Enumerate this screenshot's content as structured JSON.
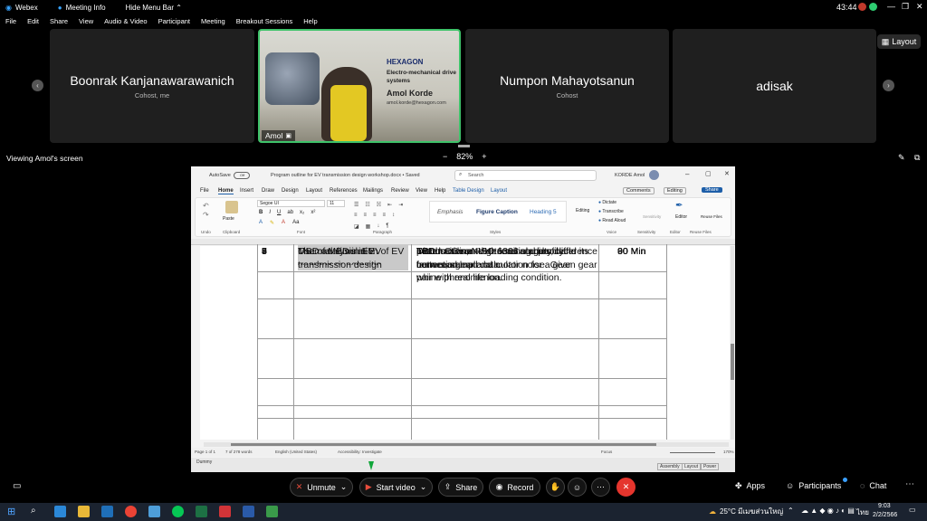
{
  "titlebar": {
    "app": "Webex",
    "meeting_info": "Meeting Info",
    "hide_menu": "Hide Menu Bar ⌃",
    "time": "43:44"
  },
  "menu": [
    "File",
    "Edit",
    "Share",
    "View",
    "Audio & Video",
    "Participant",
    "Meeting",
    "Breakout Sessions",
    "Help"
  ],
  "layout_label": "Layout",
  "participants": [
    {
      "name": "Boonrak Kanjanawarawanich",
      "role": "Cohost, me"
    },
    {
      "name": "Amol",
      "role": ""
    },
    {
      "name": "Numpon Mahayotsanun",
      "role": "Cohost"
    },
    {
      "name": "adisak",
      "role": ""
    }
  ],
  "video_slide": {
    "brand": "HEXAGON",
    "line1": "Electro-mechanical drive",
    "line2": "systems",
    "presenter": "Amol Korde",
    "email": "amol.korde@hexagon.com"
  },
  "viewing": "Viewing Amol's screen",
  "zoom": "82%",
  "word": {
    "autosave": "AutoSave",
    "autosave_state": "Off",
    "doc_title": "Program outline for EV transmission design workshop.docx • Saved",
    "search": "Search",
    "user": "KORDE Amol",
    "tabs": [
      "File",
      "Home",
      "Insert",
      "Draw",
      "Design",
      "Layout",
      "References",
      "Mailings",
      "Review",
      "View",
      "Help",
      "Table Design",
      "Layout"
    ],
    "comments": "Comments",
    "editing": "Editing",
    "share": "Share",
    "font": "Segoe UI",
    "font_size": "11",
    "styles": [
      "Emphasis",
      "Figure Caption",
      "Heading 5"
    ],
    "ribbon_groups": [
      "Undo",
      "Clipboard",
      "Font",
      "Paragraph",
      "Styles",
      "Voice",
      "Sensitivity",
      "Editor",
      "Reuse Files"
    ],
    "ribbon_buttons": [
      "Paste",
      "Dictate",
      "Transcribe",
      "Read Aloud",
      "Editing",
      "Sensitivity",
      "Editor",
      "Reuse Files"
    ],
    "status": [
      "Page 1 of 1",
      "7 of 278 words",
      "English (United States)",
      "Accessibility: Investigate",
      "Focus",
      "170%"
    ],
    "zoom_level": "170%"
  },
  "table_rows": [
    {
      "num": "",
      "topic": "",
      "desc": "pattern. Gear teeth lead and profile correction.",
      "time": ""
    },
    {
      "num": "4",
      "topic": "Gearbox duty cycle generation",
      "desc": "Load cases and generating duty cycle from road load data.",
      "time": "60 Min"
    },
    {
      "num": "5",
      "topic": "Gear rating using ISO 6336",
      "desc": "Discussion on ISO 6336 standard and its factors, sample calculation for a given gear pair with real life loading condition.",
      "time": "90 Min"
    },
    {
      "num": "6",
      "topic": "Introduction to gearbox NVH",
      "desc": "Introduction, NVH terminologies, difference between gear and motor noise. Gear whine phenomenon.",
      "time": "60 Min"
    },
    {
      "num": "7",
      "topic": "Use of MBD in EV transmission design",
      "desc": "TBD",
      "time": "60 Min"
    },
    {
      "num": "8",
      "topic": "MBD analysis in EV",
      "desc": "TBD",
      "time": "90 Min"
    },
    {
      "num": "9",
      "topic": "Thermal simulation of EV gearbox or acoustic",
      "desc": "TBD * Online",
      "time": "90 Min"
    }
  ],
  "lower_bar": {
    "dummy": "Dummy",
    "tabs": [
      "Assembly",
      "Layout",
      "Power"
    ]
  },
  "controls": {
    "unmute": "Unmute",
    "start_video": "Start video",
    "share": "Share",
    "record": "Record",
    "apps": "Apps",
    "participants": "Participants",
    "chat": "Chat"
  },
  "taskbar": {
    "weather": "25°C มีเมฆส่วนใหญ่",
    "lang": "ไทย",
    "time": "9:03",
    "date": "2/2/2566"
  }
}
